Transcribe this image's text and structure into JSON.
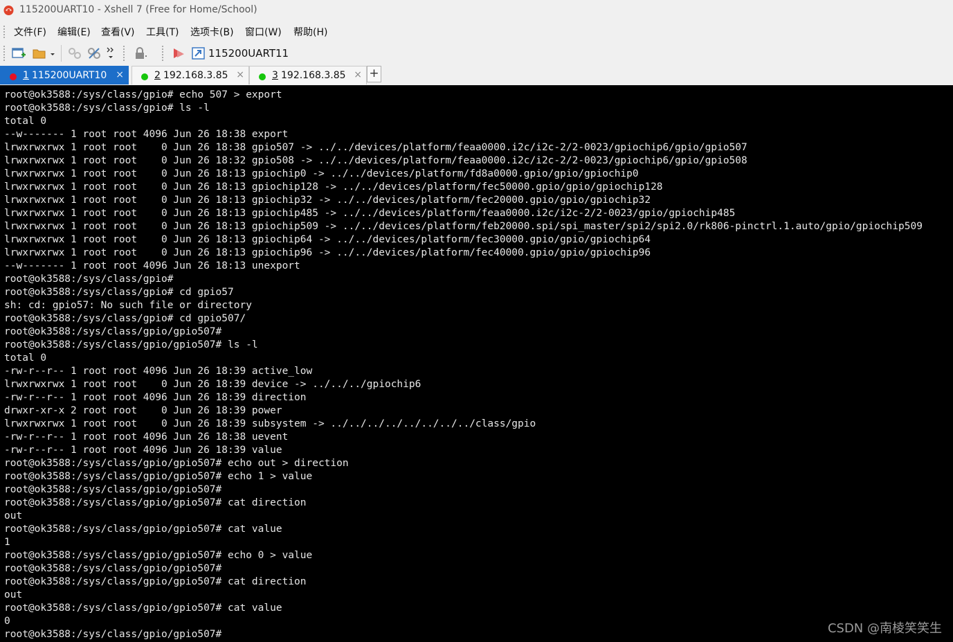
{
  "window": {
    "title": "115200UART10 - Xshell 7 (Free for Home/School)"
  },
  "menu": {
    "items": [
      "文件(F)",
      "编辑(E)",
      "查看(V)",
      "工具(T)",
      "选项卡(B)",
      "窗口(W)",
      "帮助(H)"
    ]
  },
  "toolbar": {
    "session_label": "115200UART11"
  },
  "tabs": [
    {
      "num": "1",
      "label": "115200UART10",
      "status_color": "#e81123",
      "active": true
    },
    {
      "num": "2",
      "label": "192.168.3.85",
      "status_color": "#16c60c",
      "active": false
    },
    {
      "num": "3",
      "label": "192.168.3.85",
      "status_color": "#16c60c",
      "active": false
    }
  ],
  "add_tab_label": "+",
  "tab_close_glyph": "×",
  "terminal": {
    "lines": [
      "root@ok3588:/sys/class/gpio# echo 507 > export",
      "root@ok3588:/sys/class/gpio# ls -l",
      "total 0",
      "--w------- 1 root root 4096 Jun 26 18:38 export",
      "lrwxrwxrwx 1 root root    0 Jun 26 18:38 gpio507 -> ../../devices/platform/feaa0000.i2c/i2c-2/2-0023/gpiochip6/gpio/gpio507",
      "lrwxrwxrwx 1 root root    0 Jun 26 18:32 gpio508 -> ../../devices/platform/feaa0000.i2c/i2c-2/2-0023/gpiochip6/gpio/gpio508",
      "lrwxrwxrwx 1 root root    0 Jun 26 18:13 gpiochip0 -> ../../devices/platform/fd8a0000.gpio/gpio/gpiochip0",
      "lrwxrwxrwx 1 root root    0 Jun 26 18:13 gpiochip128 -> ../../devices/platform/fec50000.gpio/gpio/gpiochip128",
      "lrwxrwxrwx 1 root root    0 Jun 26 18:13 gpiochip32 -> ../../devices/platform/fec20000.gpio/gpio/gpiochip32",
      "lrwxrwxrwx 1 root root    0 Jun 26 18:13 gpiochip485 -> ../../devices/platform/feaa0000.i2c/i2c-2/2-0023/gpio/gpiochip485",
      "lrwxrwxrwx 1 root root    0 Jun 26 18:13 gpiochip509 -> ../../devices/platform/feb20000.spi/spi_master/spi2/spi2.0/rk806-pinctrl.1.auto/gpio/gpiochip509",
      "lrwxrwxrwx 1 root root    0 Jun 26 18:13 gpiochip64 -> ../../devices/platform/fec30000.gpio/gpio/gpiochip64",
      "lrwxrwxrwx 1 root root    0 Jun 26 18:13 gpiochip96 -> ../../devices/platform/fec40000.gpio/gpio/gpiochip96",
      "--w------- 1 root root 4096 Jun 26 18:13 unexport",
      "root@ok3588:/sys/class/gpio#",
      "root@ok3588:/sys/class/gpio# cd gpio57",
      "sh: cd: gpio57: No such file or directory",
      "root@ok3588:/sys/class/gpio# cd gpio507/",
      "root@ok3588:/sys/class/gpio/gpio507#",
      "root@ok3588:/sys/class/gpio/gpio507# ls -l",
      "total 0",
      "-rw-r--r-- 1 root root 4096 Jun 26 18:39 active_low",
      "lrwxrwxrwx 1 root root    0 Jun 26 18:39 device -> ../../../gpiochip6",
      "-rw-r--r-- 1 root root 4096 Jun 26 18:39 direction",
      "drwxr-xr-x 2 root root    0 Jun 26 18:39 power",
      "lrwxrwxrwx 1 root root    0 Jun 26 18:39 subsystem -> ../../../../../../../../class/gpio",
      "-rw-r--r-- 1 root root 4096 Jun 26 18:38 uevent",
      "-rw-r--r-- 1 root root 4096 Jun 26 18:39 value",
      "root@ok3588:/sys/class/gpio/gpio507# echo out > direction",
      "root@ok3588:/sys/class/gpio/gpio507# echo 1 > value",
      "root@ok3588:/sys/class/gpio/gpio507#",
      "root@ok3588:/sys/class/gpio/gpio507# cat direction",
      "out",
      "root@ok3588:/sys/class/gpio/gpio507# cat value",
      "1",
      "root@ok3588:/sys/class/gpio/gpio507# echo 0 > value",
      "root@ok3588:/sys/class/gpio/gpio507#",
      "root@ok3588:/sys/class/gpio/gpio507# cat direction",
      "out",
      "root@ok3588:/sys/class/gpio/gpio507# cat value",
      "0",
      "root@ok3588:/sys/class/gpio/gpio507#"
    ]
  },
  "watermark": "CSDN @南棱笑笑生",
  "icons": {
    "app": "xshell-logo-icon",
    "toolbar": [
      "new-session-icon",
      "open-folder-icon",
      "dropdown-icon",
      "connect-icon",
      "disconnect-icon",
      "more-icon",
      "lock-icon",
      "transfer-icon",
      "xftp-icon"
    ]
  },
  "colors": {
    "terminal_bg": "#000000",
    "terminal_fg": "#e6e6e6",
    "active_tab": "#1c6ec9"
  }
}
